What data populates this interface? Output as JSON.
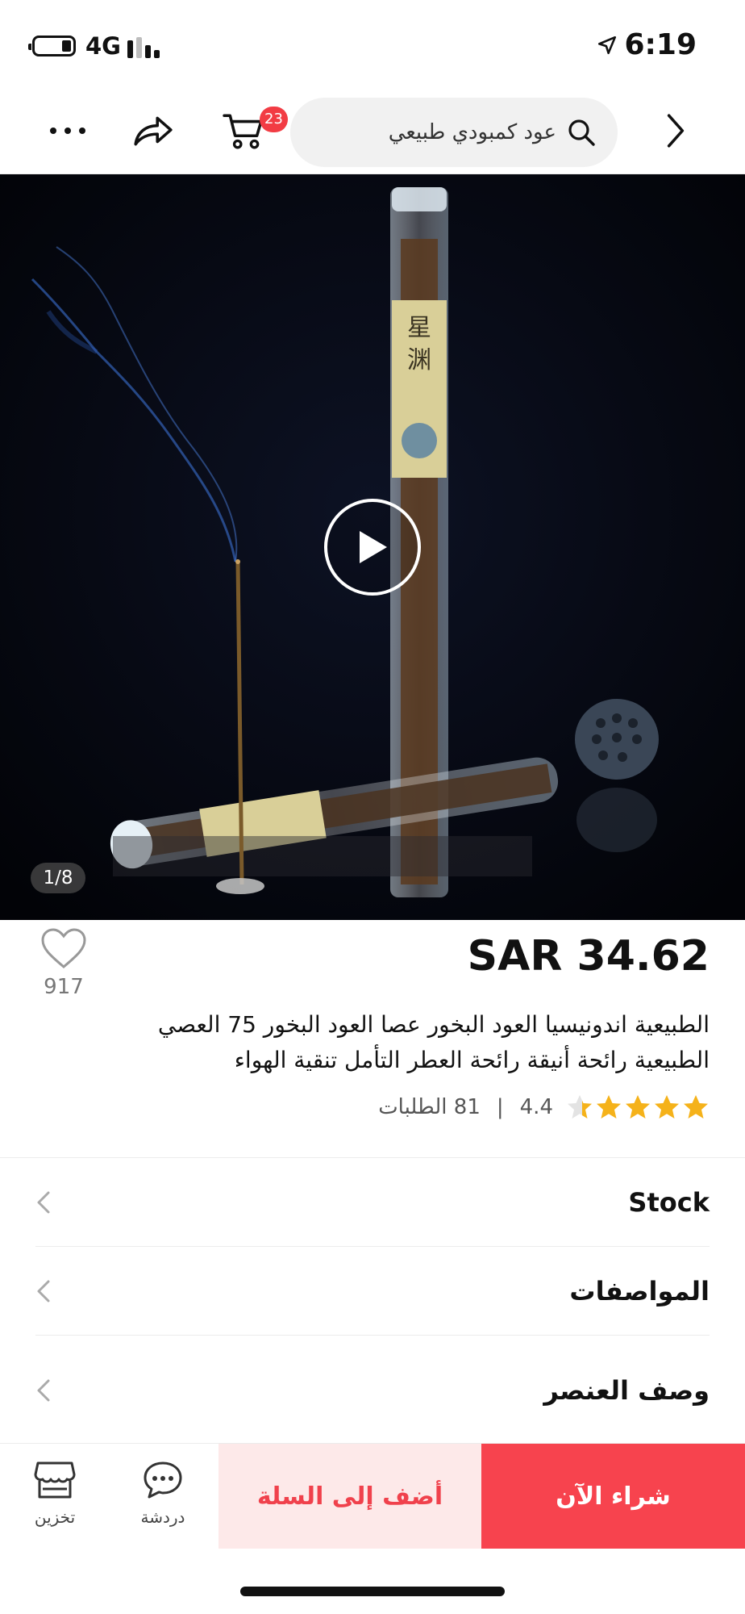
{
  "status_bar": {
    "network": "4G",
    "time": "6:19",
    "icons": [
      "battery-icon",
      "signal-icon",
      "location-arrow-icon"
    ]
  },
  "nav": {
    "search_value": "عود كمبودي طبيعي",
    "cart_count": "23",
    "icons": [
      "more-icon",
      "share-icon",
      "cart-icon",
      "search-icon",
      "chevron-right-icon"
    ]
  },
  "media": {
    "counter": "1/8",
    "icons": [
      "play-icon"
    ],
    "description_colors": {
      "background": "#050710",
      "tube_label": "#d9cf98",
      "tube_glass": "#d6e4ee"
    }
  },
  "product": {
    "price": "SAR 34.62",
    "favorites": "917",
    "title": "الطبيعية اندونيسيا العود البخور عصا العود البخور 75 العصي الطبيعية رائحة أنيقة رائحة العطر التأمل تنقية الهواء",
    "rating": "4.4",
    "rating_stars": 4.4,
    "rating_separator": "|",
    "orders": "81 الطلبات",
    "star_color": "#f5b21a"
  },
  "sections": [
    {
      "label": "Stock"
    },
    {
      "label": "المواصفات"
    },
    {
      "label": "وصف العنصر"
    }
  ],
  "actions": {
    "store_label": "تخزين",
    "chat_label": "دردشة",
    "add_to_cart_label": "أضف إلى السلة",
    "buy_now_label": "شراء الآن",
    "accent_color": "#f7434e"
  }
}
